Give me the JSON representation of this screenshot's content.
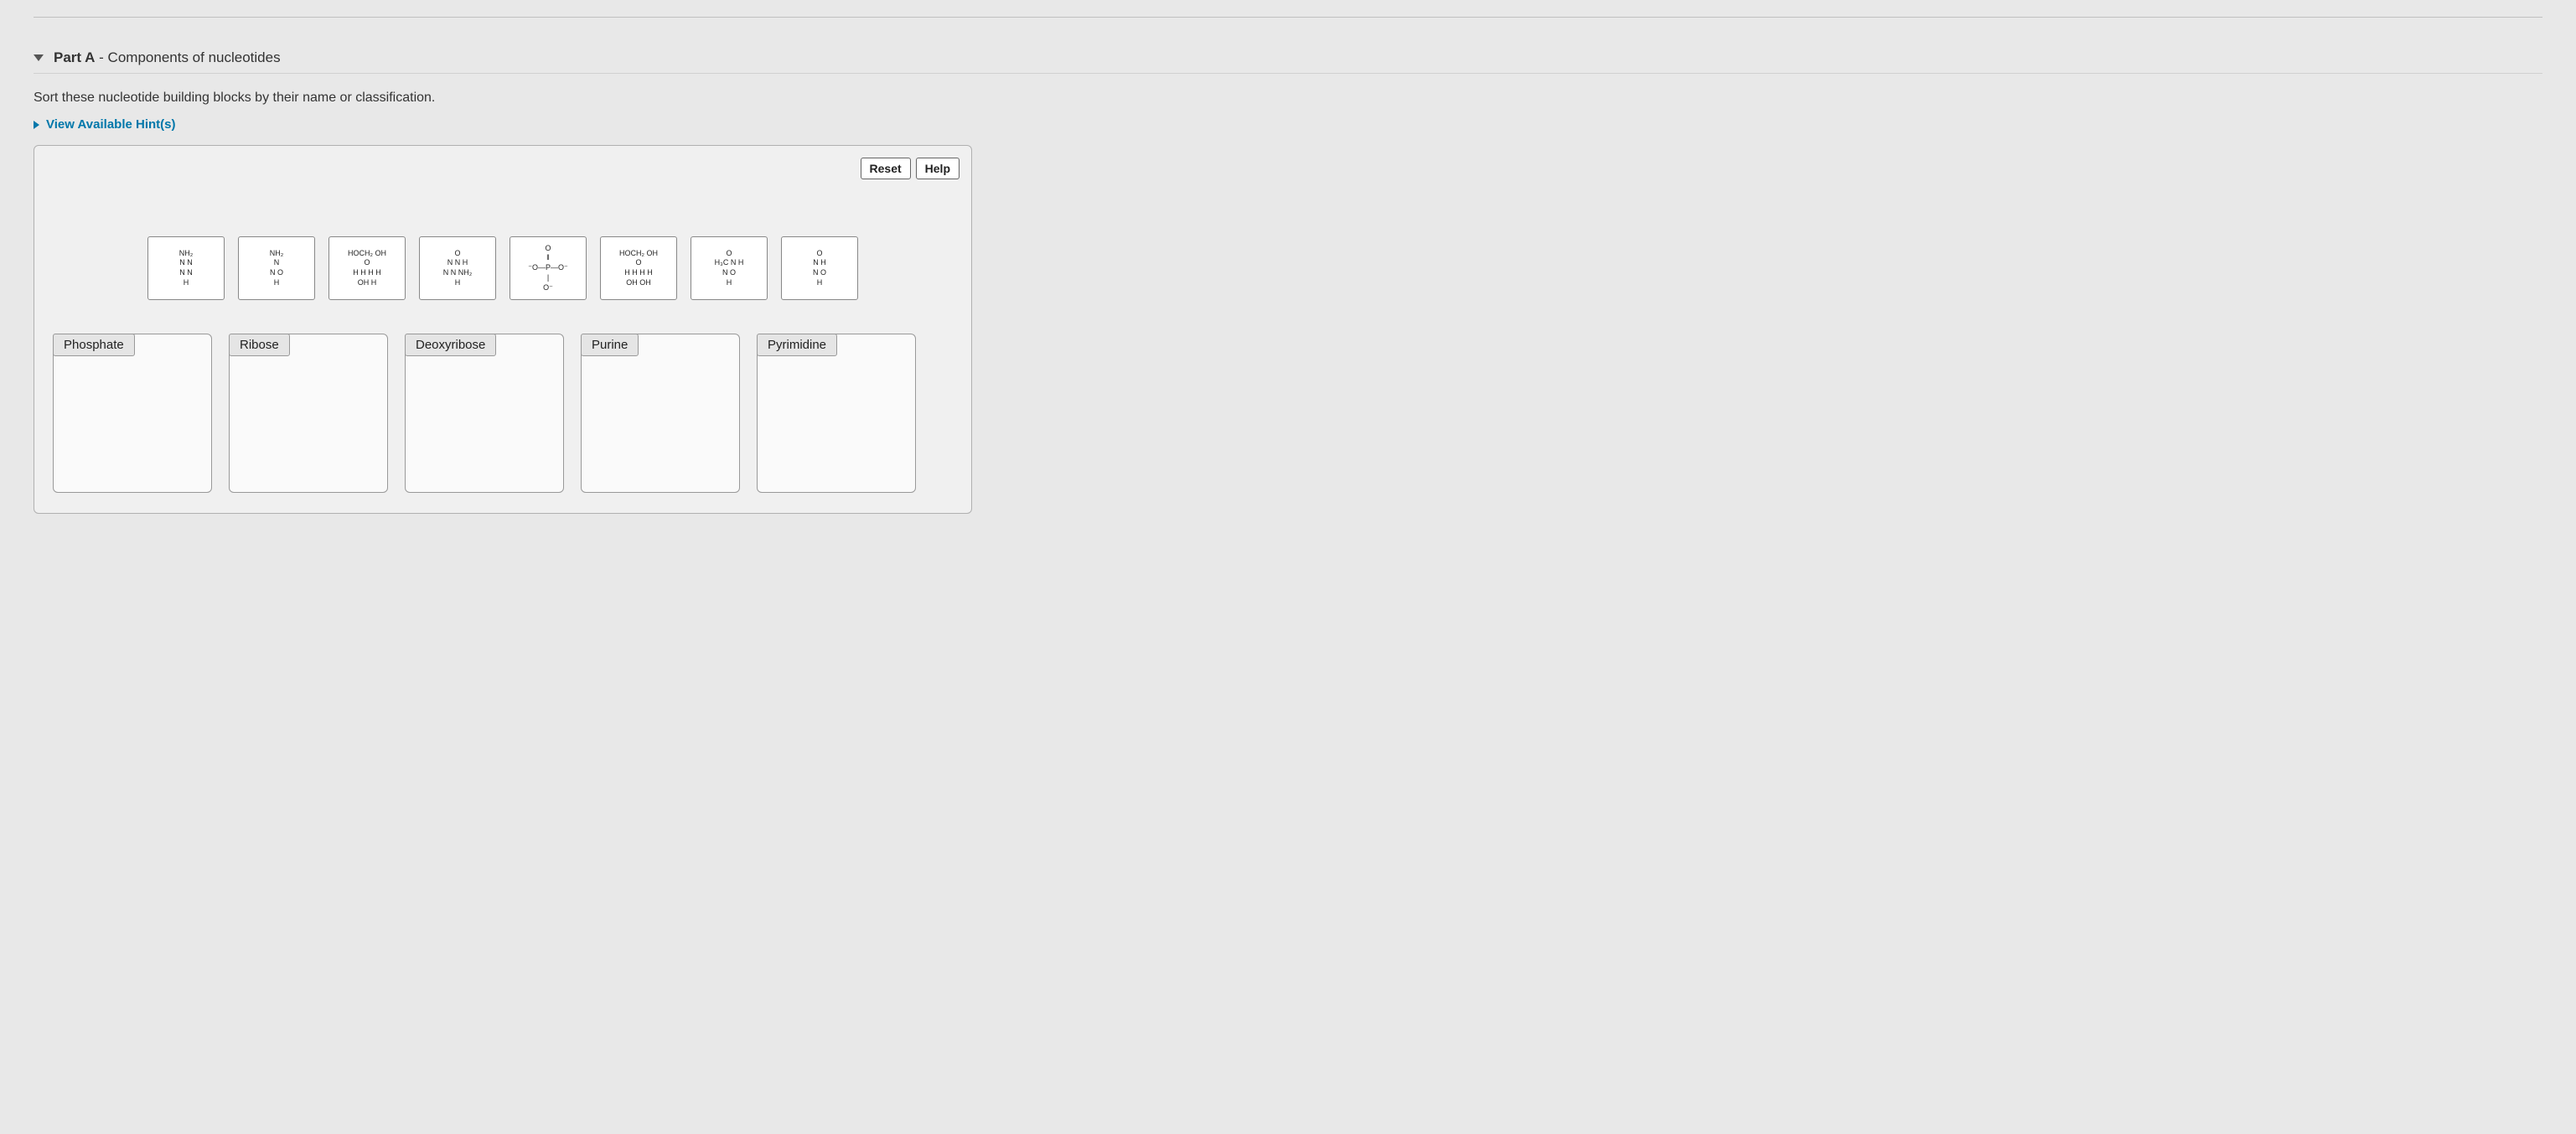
{
  "part": {
    "label_bold": "Part A",
    "label_rest": " - Components of nucleotides"
  },
  "instructions": "Sort these nucleotide building blocks by their name or classification.",
  "hints_link": "View Available Hint(s)",
  "buttons": {
    "reset": "Reset",
    "help": "Help"
  },
  "items": [
    {
      "id": "adenine",
      "display": "NH₂\nN   N\nN   N\nH",
      "desc": "purine-adenine-structure"
    },
    {
      "id": "cytosine",
      "display": "NH₂\nN\nN   O\nH",
      "desc": "pyrimidine-cytosine-structure"
    },
    {
      "id": "deoxyribose",
      "display": "HOCH₂  OH\n O\nH H H H\nOH H",
      "desc": "deoxyribose-sugar-structure"
    },
    {
      "id": "guanine",
      "display": "O\nN   N H\nN   N  NH₂\nH",
      "desc": "purine-guanine-structure"
    },
    {
      "id": "phosphate",
      "display": "O\n‖\n⁻O—P—O⁻\n|\nO⁻",
      "desc": "phosphate-group-structure"
    },
    {
      "id": "ribose",
      "display": "HOCH₂  OH\n O\nH H H H\nOH OH",
      "desc": "ribose-sugar-structure"
    },
    {
      "id": "thymine",
      "display": "O\nH₃C   N H\nN   O\nH",
      "desc": "pyrimidine-thymine-structure"
    },
    {
      "id": "uracil",
      "display": "O\nN H\nN   O\nH",
      "desc": "pyrimidine-uracil-structure"
    }
  ],
  "bins": [
    {
      "label": "Phosphate"
    },
    {
      "label": "Ribose"
    },
    {
      "label": "Deoxyribose"
    },
    {
      "label": "Purine"
    },
    {
      "label": "Pyrimidine"
    }
  ]
}
